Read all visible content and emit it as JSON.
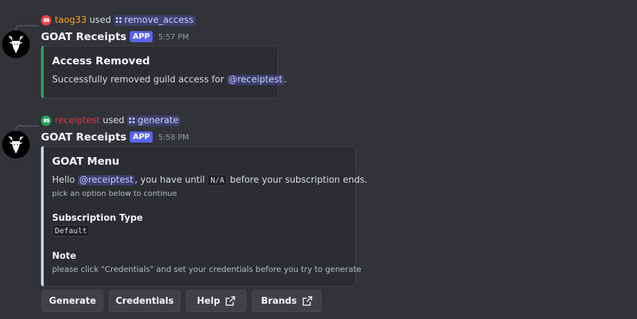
{
  "messages": [
    {
      "reply": {
        "username": "taog33",
        "username_color": "#faa61a",
        "avatar_color": "#ed4245",
        "used_text": "used",
        "command": "remove_access"
      },
      "author": "GOAT Receipts",
      "tag": "APP",
      "time": "5:57 PM",
      "embed": {
        "accent": "#23a55a",
        "title": "Access Removed",
        "text_before": "Successfully removed guild access for ",
        "mention": "@receiptest",
        "text_after": "."
      }
    },
    {
      "reply": {
        "username": "receiptest",
        "username_color": "#d83c3e",
        "avatar_color": "#23a55a",
        "used_text": "used",
        "command": "generate"
      },
      "author": "GOAT Receipts",
      "tag": "APP",
      "time": "5:58 PM",
      "embed": {
        "accent": "#c9cdfb",
        "title": "GOAT Menu",
        "hello": "Hello ",
        "mention": "@receiptest",
        "mid": ", you have until ",
        "until_code": "N/A",
        "end": " before your subscription ends.",
        "subtext": "pick an option below to continue",
        "field1_name": "Subscription Type",
        "field1_value": "Default",
        "field2_name": "Note",
        "field2_value": "please click \"Credentials\" and set your credentials before you try to generate"
      }
    }
  ],
  "buttons": [
    {
      "label": "Generate",
      "external": false
    },
    {
      "label": "Credentials",
      "external": false
    },
    {
      "label": "Help",
      "external": true
    },
    {
      "label": "Brands",
      "external": true
    }
  ]
}
